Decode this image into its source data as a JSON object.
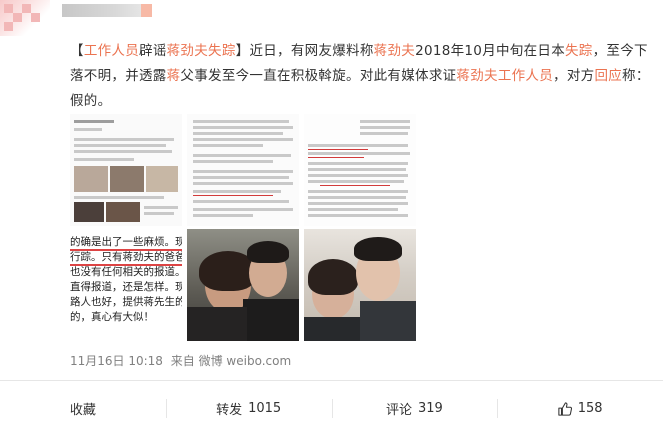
{
  "post": {
    "text_parts": {
      "bracket_open": "【",
      "tag_text": "工作人员",
      "tag_rest": "辟谣",
      "name1": "蒋劲夫",
      "missing1": "失踪",
      "bracket_close": "】",
      "seg1": "近日，有网友爆料称",
      "name2": "蒋劲夫",
      "seg2": "2018年10月中旬在日本",
      "missing2": "失踪",
      "seg3": "，至今下落不明，并透露",
      "name3": "蒋",
      "seg4": "父事发至今一直在积极斡旋。对此有媒体求证",
      "name4": "蒋劲夫",
      "staff": "工作人员",
      "seg5": "，对方",
      "respond": "回应",
      "seg6": "称：假的。"
    },
    "image4_lines": [
      "的确是出了一些麻烦。现在",
      "行踪。只有蒋劲夫的爸爸在积",
      "也没有任何相关的报道。不",
      "直得报道，还是怎样。现在希",
      "路人也好，提供蒋先生的行",
      "的，真心有大似！"
    ],
    "timestamp": "11月16日 10:18",
    "source_prefix": "来自",
    "source": "微博 weibo.com"
  },
  "actions": {
    "favorite_label": "收藏",
    "repost_label": "转发",
    "repost_count": "1015",
    "comment_label": "评论",
    "comment_count": "319",
    "like_count": "158"
  },
  "colors": {
    "link": "#eb7350",
    "text": "#333333",
    "meta": "#808080",
    "divider": "#e6e6e6"
  }
}
